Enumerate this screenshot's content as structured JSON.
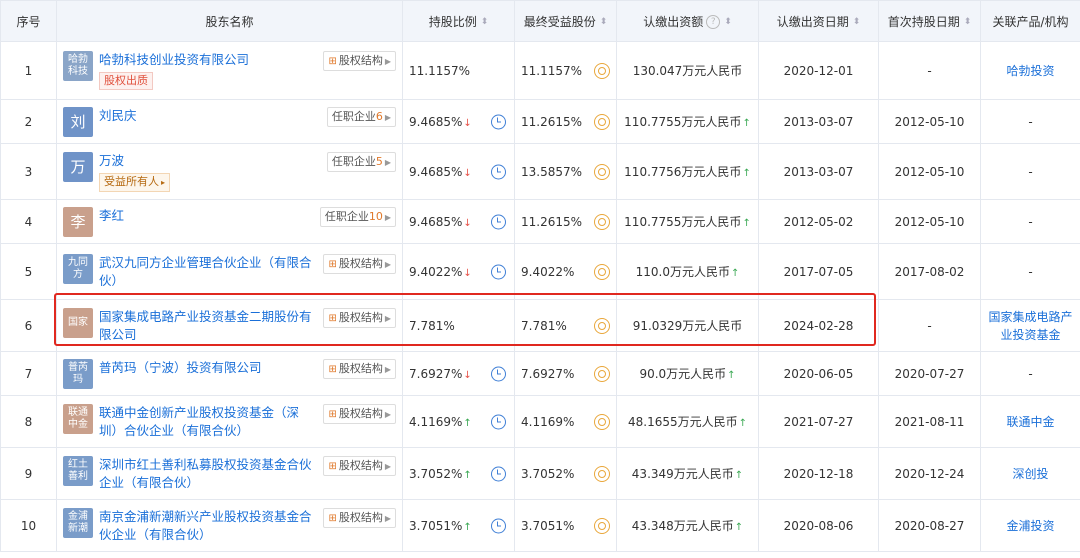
{
  "headers": {
    "index": "序号",
    "name": "股东名称",
    "ratio": "持股比例",
    "final": "最终受益股份",
    "capital": "认缴出资额",
    "capital_date": "认缴出资日期",
    "first_date": "首次持股日期",
    "related": "关联产品/机构"
  },
  "rows": [
    {
      "index": "1",
      "logo": "哈勃\n科技",
      "logo_color": "#8aa5c8",
      "name": "哈勃科技创业投资有限公司",
      "tag": "股权出质",
      "tag_style": "red",
      "button": "股权结构",
      "button_num": "",
      "ratio": "11.1157%",
      "ratio_trend": "",
      "final": "11.1157%",
      "capital": "130.047万元人民币",
      "capital_trend": "",
      "capital_date": "2020-12-01",
      "first_date": "-",
      "related": "哈勃投资",
      "related_link": true
    },
    {
      "index": "2",
      "logo": "刘",
      "logo_color": "#6f93c8",
      "name": "刘民庆",
      "tag": "",
      "tag_style": "",
      "button": "任职企业",
      "button_num": "6",
      "ratio": "9.4685%",
      "ratio_trend": "down",
      "final": "11.2615%",
      "capital": "110.7755万元人民币",
      "capital_trend": "up",
      "capital_date": "2013-03-07",
      "first_date": "2012-05-10",
      "related": "-",
      "related_link": false
    },
    {
      "index": "3",
      "logo": "万",
      "logo_color": "#6f93c8",
      "name": "万波",
      "tag": "受益所有人",
      "tag_style": "orange",
      "button": "任职企业",
      "button_num": "5",
      "ratio": "9.4685%",
      "ratio_trend": "down",
      "final": "13.5857%",
      "capital": "110.7756万元人民币",
      "capital_trend": "up",
      "capital_date": "2013-03-07",
      "first_date": "2012-05-10",
      "related": "-",
      "related_link": false
    },
    {
      "index": "4",
      "logo": "李",
      "logo_color": "#c9a08c",
      "name": "李红",
      "tag": "",
      "tag_style": "",
      "button": "任职企业",
      "button_num": "10",
      "ratio": "9.4685%",
      "ratio_trend": "down",
      "final": "11.2615%",
      "capital": "110.7755万元人民币",
      "capital_trend": "up",
      "capital_date": "2012-05-02",
      "first_date": "2012-05-10",
      "related": "-",
      "related_link": false
    },
    {
      "index": "5",
      "logo": "九同\n方",
      "logo_color": "#7a9cc9",
      "name": "武汉九同方企业管理合伙企业（有限合伙）",
      "tag": "",
      "tag_style": "",
      "button": "股权结构",
      "button_num": "",
      "ratio": "9.4022%",
      "ratio_trend": "down",
      "final": "9.4022%",
      "capital": "110.0万元人民币",
      "capital_trend": "up",
      "capital_date": "2017-07-05",
      "first_date": "2017-08-02",
      "related": "-",
      "related_link": false
    },
    {
      "index": "6",
      "logo": "国家",
      "logo_color": "#c9a08c",
      "name": "国家集成电路产业投资基金二期股份有限公司",
      "tag": "",
      "tag_style": "",
      "button": "股权结构",
      "button_num": "",
      "ratio": "7.781%",
      "ratio_trend": "",
      "final": "7.781%",
      "capital": "91.0329万元人民币",
      "capital_trend": "",
      "capital_date": "2024-02-28",
      "first_date": "-",
      "related": "国家集成电路产业投资基金",
      "related_link": true
    },
    {
      "index": "7",
      "logo": "普芮\n玛",
      "logo_color": "#7a9cc9",
      "name": "普芮玛（宁波）投资有限公司",
      "tag": "",
      "tag_style": "",
      "button": "股权结构",
      "button_num": "",
      "ratio": "7.6927%",
      "ratio_trend": "down",
      "final": "7.6927%",
      "capital": "90.0万元人民币",
      "capital_trend": "up",
      "capital_date": "2020-06-05",
      "first_date": "2020-07-27",
      "related": "-",
      "related_link": false
    },
    {
      "index": "8",
      "logo": "联通\n中金",
      "logo_color": "#c9a08c",
      "name": "联通中金创新产业股权投资基金（深圳）合伙企业（有限合伙）",
      "tag": "",
      "tag_style": "",
      "button": "股权结构",
      "button_num": "",
      "ratio": "4.1169%",
      "ratio_trend": "up",
      "final": "4.1169%",
      "capital": "48.1655万元人民币",
      "capital_trend": "up",
      "capital_date": "2021-07-27",
      "first_date": "2021-08-11",
      "related": "联通中金",
      "related_link": true
    },
    {
      "index": "9",
      "logo": "红土\n善利",
      "logo_color": "#7a9cc9",
      "name": "深圳市红土善利私募股权投资基金合伙企业（有限合伙）",
      "tag": "",
      "tag_style": "",
      "button": "股权结构",
      "button_num": "",
      "ratio": "3.7052%",
      "ratio_trend": "up",
      "final": "3.7052%",
      "capital": "43.349万元人民币",
      "capital_trend": "up",
      "capital_date": "2020-12-18",
      "first_date": "2020-12-24",
      "related": "深创投",
      "related_link": true
    },
    {
      "index": "10",
      "logo": "金浦\n新潮",
      "logo_color": "#7a9cc9",
      "name": "南京金浦新潮新兴产业股权投资基金合伙企业（有限合伙）",
      "tag": "",
      "tag_style": "",
      "button": "股权结构",
      "button_num": "",
      "ratio": "3.7051%",
      "ratio_trend": "up",
      "final": "3.7051%",
      "capital": "43.348万元人民币",
      "capital_trend": "up",
      "capital_date": "2020-08-06",
      "first_date": "2020-08-27",
      "related": "金浦投资",
      "related_link": true
    }
  ]
}
